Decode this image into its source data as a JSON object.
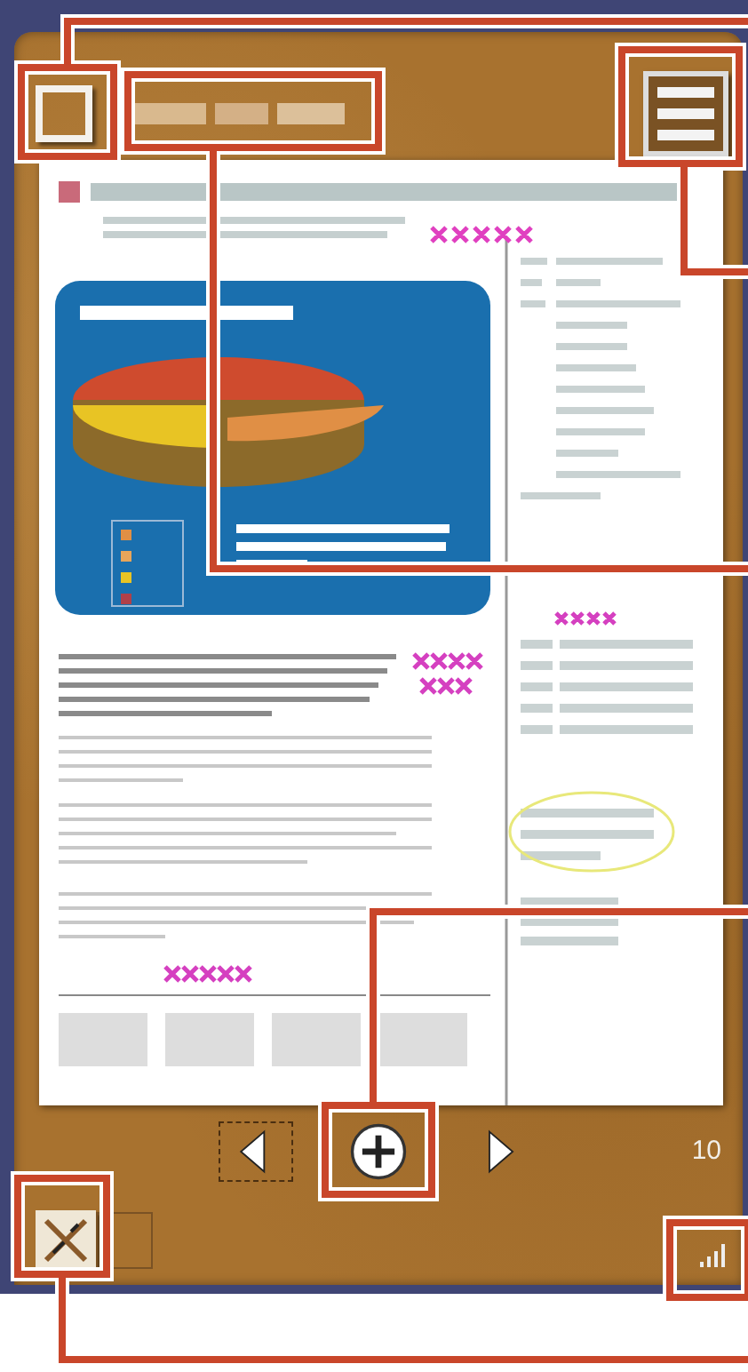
{
  "pager": {
    "page_number": "10",
    "buttons": [
      {
        "kind": "prev",
        "focused": true
      },
      {
        "kind": "add",
        "focused": false
      },
      {
        "kind": "next",
        "focused": false
      }
    ]
  }
}
